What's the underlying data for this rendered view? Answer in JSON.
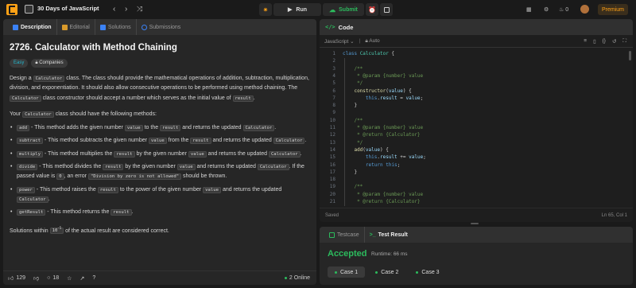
{
  "app": {
    "problem_list_title": "30 Days of JavaScript",
    "run_label": "Run",
    "submit_label": "Submit",
    "streak_count": "0",
    "premium_label": "Premium"
  },
  "description_panel": {
    "tabs": [
      {
        "label": "Description"
      },
      {
        "label": "Editorial"
      },
      {
        "label": "Solutions"
      },
      {
        "label": "Submissions"
      }
    ],
    "title": "2726. Calculator with Method Chaining",
    "difficulty": "Easy",
    "companies_label": "Companies",
    "intro": {
      "t1": "Design a ",
      "c1": "Calculator",
      "t2": " class. The class should provide the mathematical operations of addition, subtraction, multiplication, division, and exponentiation. It should also allow consecutive operations to be performed using method chaining. The ",
      "c2": "Calculator",
      "t3": " class constructor should accept a number which serves as the initial value of ",
      "c3": "result",
      "t4": "."
    },
    "methods_intro": {
      "t1": "Your ",
      "c1": "Calculator",
      "t2": " class should have the following methods:"
    },
    "methods": {
      "add": {
        "c1": "add",
        "t1": " - This method adds the given number ",
        "c2": "value",
        "t2": " to the ",
        "c3": "result",
        "t3": " and returns the updated ",
        "c4": "Calculator",
        "t4": "."
      },
      "subtract": {
        "c1": "subtract",
        "t1": " - This method subtracts the given number ",
        "c2": "value",
        "t2": " from the ",
        "c3": "result",
        "t3": " and returns the updated ",
        "c4": "Calculator",
        "t4": "."
      },
      "multiply": {
        "c1": "multiply",
        "t1": " - This method multiplies the ",
        "c2": "result",
        "t2": " by the given number ",
        "c3": "value",
        "t3": " and returns the updated ",
        "c4": "Calculator",
        "t4": "."
      },
      "divide": {
        "c1": "divide",
        "t1": " - This method divides the ",
        "c2": "result",
        "t2": " by the given number ",
        "c3": "value",
        "t3": " and returns the updated ",
        "c4": "Calculator",
        "t4": ". If the passed value is ",
        "c5": "0",
        "t5": ", an error ",
        "c6": "\"Division by zero is not allowed\"",
        "t6": " should be thrown."
      },
      "power": {
        "c1": "power",
        "t1": " - This method raises the ",
        "c2": "result",
        "t2": " to the power of the given number ",
        "c3": "value",
        "t3": " and returns the updated ",
        "c4": "Calculator",
        "t4": "."
      },
      "getResult": {
        "c1": "getResult",
        "t1": " - This method returns the ",
        "c2": "result",
        "t2": "."
      }
    },
    "tolerance": {
      "t1": "Solutions within ",
      "c1": "10",
      "sup": "-5",
      "t2": " of the actual result are considered correct."
    },
    "footer": {
      "likes": "129",
      "comments": "18",
      "online": "2 Online"
    }
  },
  "code_panel": {
    "title": "Code",
    "language": "JavaScript",
    "mode": "Auto",
    "lines": [
      {
        "n": "1",
        "html": "<span class='kw'>class</span> <span class='tp'>Calculator</span> {"
      },
      {
        "n": "2",
        "html": ""
      },
      {
        "n": "3",
        "html": "    <span class='cm'>/**</span>"
      },
      {
        "n": "4",
        "html": "    <span class='cm'> * @param {number} value</span>"
      },
      {
        "n": "5",
        "html": "    <span class='cm'> */</span>"
      },
      {
        "n": "6",
        "html": "    <span class='fn'>constructor</span>(<span class='pm'>value</span>) {"
      },
      {
        "n": "7",
        "html": "        <span class='kw'>this</span>.<span class='pm'>result</span> = <span class='pm'>value</span>;"
      },
      {
        "n": "8",
        "html": "    }"
      },
      {
        "n": "9",
        "html": ""
      },
      {
        "n": "10",
        "html": "    <span class='cm'>/**</span>"
      },
      {
        "n": "11",
        "html": "    <span class='cm'> * @param {number} value</span>"
      },
      {
        "n": "12",
        "html": "    <span class='cm'> * @return {Calculator}</span>"
      },
      {
        "n": "13",
        "html": "    <span class='cm'> */</span>"
      },
      {
        "n": "14",
        "html": "    <span class='fn'>add</span>(<span class='pm'>value</span>) {"
      },
      {
        "n": "15",
        "html": "        <span class='kw'>this</span>.<span class='pm'>result</span> += <span class='pm'>value</span>;"
      },
      {
        "n": "16",
        "html": "        <span class='kw'>return</span> <span class='kw'>this</span>;"
      },
      {
        "n": "17",
        "html": "    }"
      },
      {
        "n": "18",
        "html": ""
      },
      {
        "n": "19",
        "html": "    <span class='cm'>/**</span>"
      },
      {
        "n": "20",
        "html": "    <span class='cm'> * @param {number} value</span>"
      },
      {
        "n": "21",
        "html": "    <span class='cm'> * @return {Calculator}</span>"
      }
    ],
    "status_left": "Saved",
    "status_right": "Ln 65, Col 1"
  },
  "result_panel": {
    "tabs": [
      {
        "label": "Testcase"
      },
      {
        "label": "Test Result"
      }
    ],
    "verdict": "Accepted",
    "runtime": "Runtime: 66 ms",
    "cases": [
      {
        "label": "Case 1"
      },
      {
        "label": "Case 2"
      },
      {
        "label": "Case 3"
      }
    ]
  }
}
